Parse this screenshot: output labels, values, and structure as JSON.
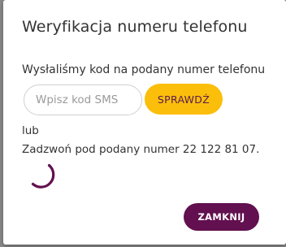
{
  "dialog": {
    "title": "Weryfikacja numeru telefonu",
    "info_text": "Wysłaliśmy kod na podany numer telefonu",
    "code_input": {
      "placeholder": "Wpisz kod SMS",
      "value": ""
    },
    "check_button_label": "SPRAWDŹ",
    "or_text": "lub",
    "call_text": "Zadzwoń pod podany numer 22 122 81 07.",
    "spinner_icon": "loading-spinner-icon",
    "close_button_label": "ZAMKNIJ"
  },
  "colors": {
    "accent_yellow": "#fbbf0b",
    "brand_purple": "#62104f",
    "backdrop": "#8a8a8a"
  }
}
